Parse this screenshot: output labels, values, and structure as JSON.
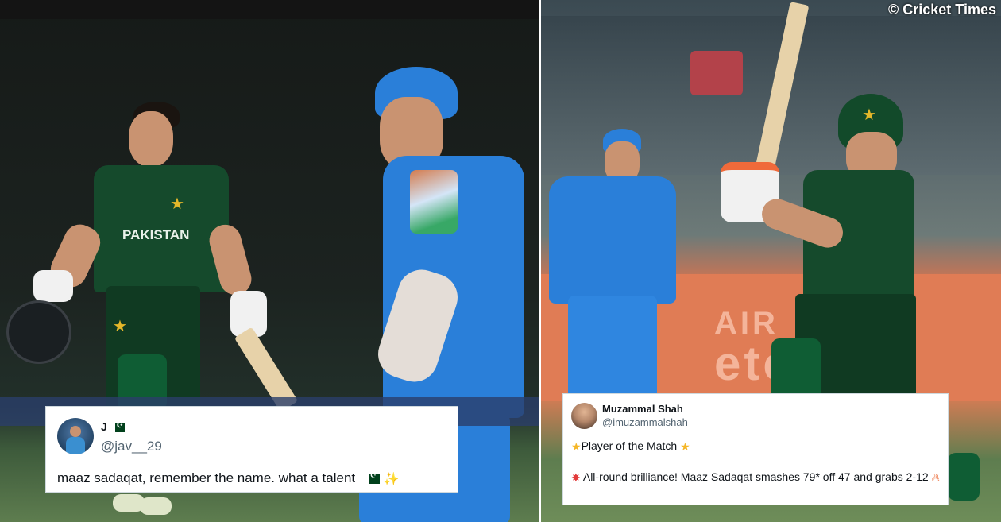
{
  "watermark": "© Cricket Times",
  "tweet_left": {
    "name": "J",
    "handle": "@jav__29",
    "text": "maaz sadaqat, remember the name. what a talent"
  },
  "tweet_right": {
    "name": "Muzammal Shah",
    "handle": "@imuzammalshah",
    "line1": "Player of the Match",
    "line2": "All-round brilliance! Maaz Sadaqat smashes 79* off 47 and grabs 2-12"
  },
  "photo_left": {
    "jersey_text": "PAKISTAN"
  },
  "photo_right": {
    "ad_text_top": "AIR",
    "ad_text_bottom": "etc"
  },
  "colors": {
    "pakistan_green": "#154a2c",
    "india_blue": "#2a7fd9",
    "banner_orange": "#e07c55",
    "tweet_bg": "#ffffff"
  }
}
